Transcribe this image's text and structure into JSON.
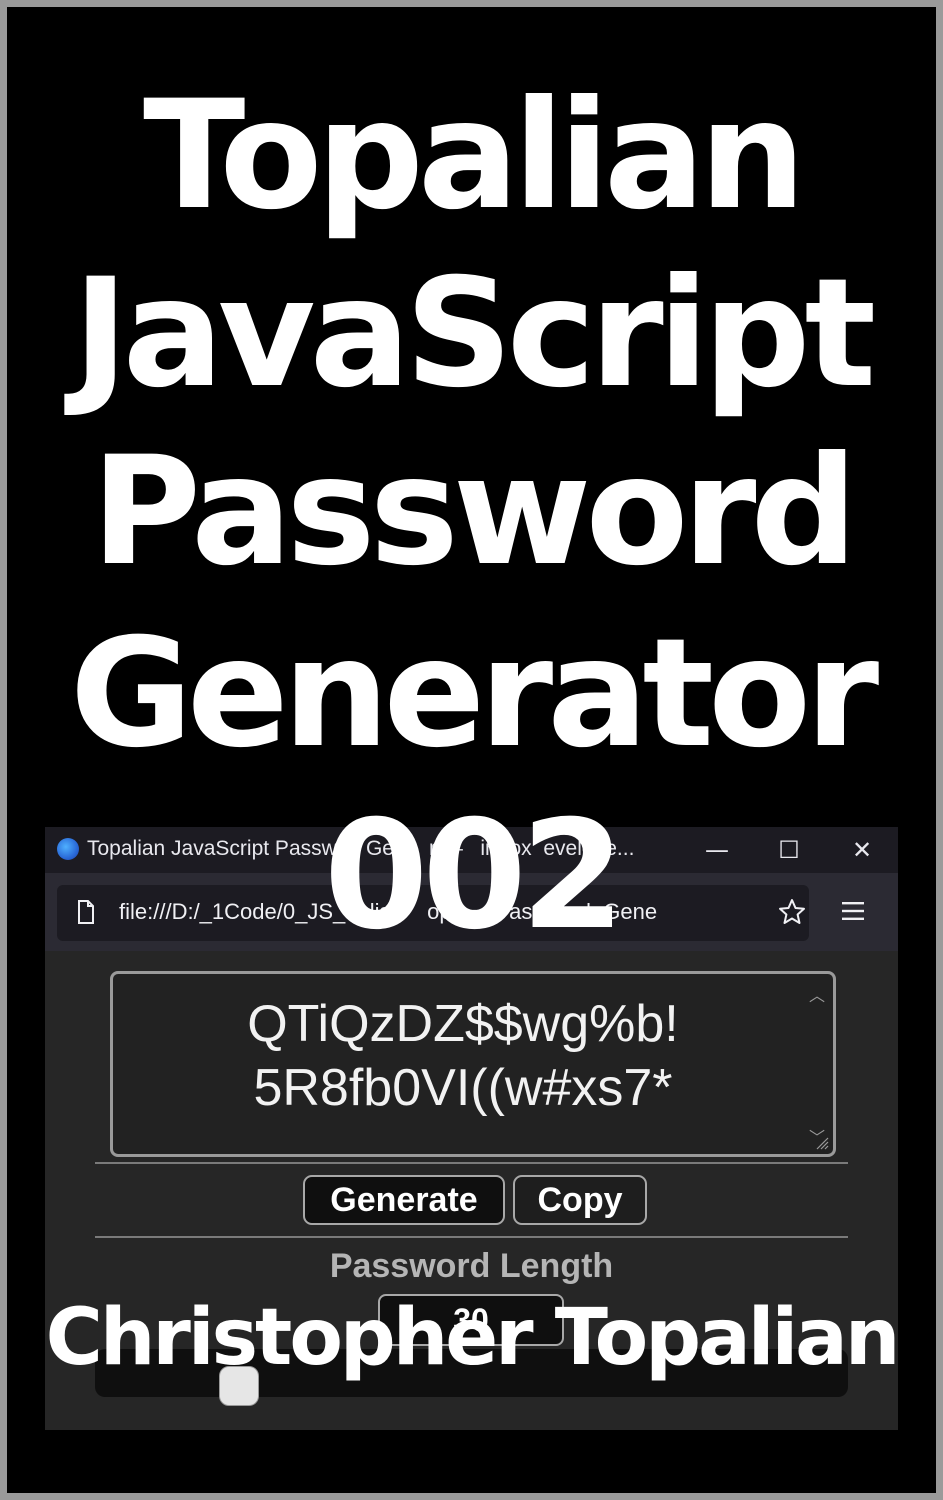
{
  "cover": {
    "title_lines": [
      "Topalian",
      "JavaScript",
      "Password",
      "Generator",
      "002"
    ],
    "author": "Christopher Topalian"
  },
  "browser": {
    "window_title": "Topalian JavaScript Passwo   Ge      r —   irefox  evelope...",
    "url": "file:///D:/_1Code/0_JS_  blish    op     _Password_Gene",
    "controls": {
      "minimize": "—",
      "maximize": "☐",
      "close": "✕"
    }
  },
  "app": {
    "password_line1": "QTiQzDZ$$wg%b!",
    "password_line2": "5R8fb0VI((w#xs7*",
    "generate_label": "Generate",
    "copy_label": "Copy",
    "length_label": "Password Length",
    "length_value": "30",
    "slider_fraction": 0.16
  },
  "colors": {
    "background": "#000000",
    "border": "#9a9a9a",
    "text": "#ffffff",
    "window_bg": "#2b2a33"
  }
}
